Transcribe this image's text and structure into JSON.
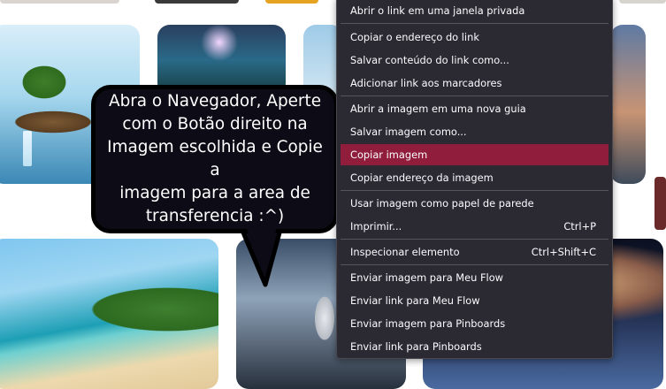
{
  "bubble": {
    "lines": [
      "Abra o Navegador, Aperte",
      "com o Botão direito na",
      "Imagem escolhida e Copie a",
      "imagem para a area de",
      "transferencia :^)"
    ]
  },
  "images": [
    {
      "name": "floating-island"
    },
    {
      "name": "night-forest"
    },
    {
      "name": "sky-clouds"
    },
    {
      "name": "sunset-shore"
    },
    {
      "name": "tropical-beach"
    },
    {
      "name": "astronaut"
    },
    {
      "name": "planet-horizon"
    }
  ],
  "context_menu": {
    "items": [
      {
        "label": "Abrir o link em uma janela privada",
        "shortcut": ""
      },
      {
        "label": "Copiar o endereço do link",
        "shortcut": ""
      },
      {
        "label": "Salvar conteúdo do link como...",
        "shortcut": ""
      },
      {
        "label": "Adicionar link aos marcadores",
        "shortcut": ""
      },
      {
        "label": "Abrir a imagem em uma nova guia",
        "shortcut": ""
      },
      {
        "label": "Salvar imagem como...",
        "shortcut": ""
      },
      {
        "label": "Copiar imagem",
        "shortcut": "",
        "highlighted": true
      },
      {
        "label": "Copiar endereço da imagem",
        "shortcut": ""
      },
      {
        "label": "Usar imagem como papel de parede",
        "shortcut": ""
      },
      {
        "label": "Imprimir...",
        "shortcut": "Ctrl+P"
      },
      {
        "label": "Inspecionar elemento",
        "shortcut": "Ctrl+Shift+C"
      },
      {
        "label": "Enviar imagem para Meu Flow",
        "shortcut": ""
      },
      {
        "label": "Enviar link para Meu Flow",
        "shortcut": ""
      },
      {
        "label": "Enviar imagem para Pinboards",
        "shortcut": ""
      },
      {
        "label": "Enviar link para Pinboards",
        "shortcut": ""
      }
    ]
  },
  "colors": {
    "menu_bg": "#2b2a33",
    "menu_highlight": "#8f1d3b",
    "bubble_bg": "#0c0b16"
  }
}
